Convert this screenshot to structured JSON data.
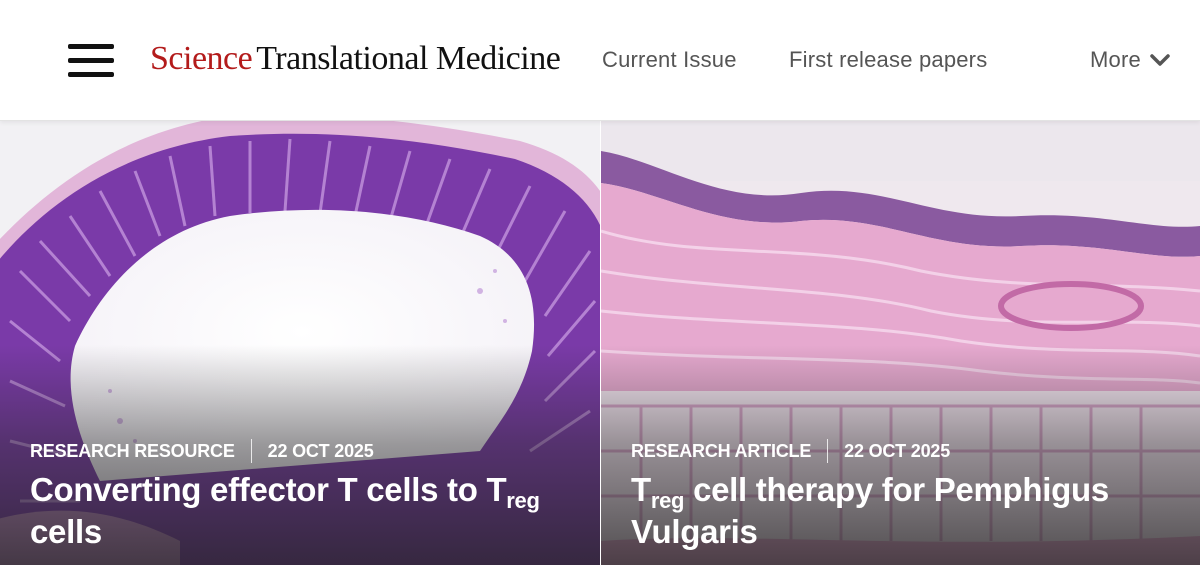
{
  "header": {
    "logo_brand": "Science",
    "logo_sub": "Translational Medicine",
    "nav": {
      "current_issue": "Current Issue",
      "first_release": "First release papers",
      "more": "More"
    }
  },
  "colors": {
    "brand_red": "#b31b1b",
    "nav_text": "#555555"
  },
  "articles": [
    {
      "type": "RESEARCH RESOURCE",
      "date": "22 OCT 2025",
      "title_pre": "Converting effector T cells to T",
      "title_sub": "reg",
      "title_post": " cells"
    },
    {
      "type": "RESEARCH ARTICLE",
      "date": "22 OCT 2025",
      "title_pre": "T",
      "title_sub": "reg",
      "title_post": " cell therapy for Pemphigus Vulgaris"
    }
  ]
}
